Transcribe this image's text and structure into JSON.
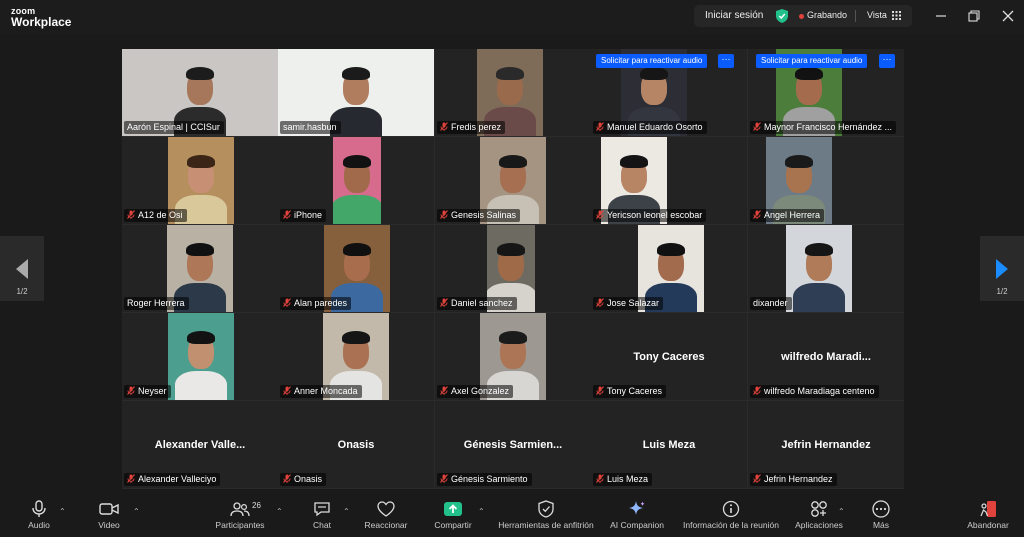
{
  "app": {
    "brand_top": "zoom",
    "brand_bottom": "Workplace"
  },
  "topbar": {
    "sign_in": "Iniciar sesión",
    "recording": "Grabando",
    "view": "Vista"
  },
  "pagination": {
    "left": "1/2",
    "right": "1/2"
  },
  "request_audio_label": "Solicitar para reactivar audio",
  "request_more": "···",
  "participants": [
    {
      "name": "Aarón Espinal | CCISur",
      "muted": false
    },
    {
      "name": "samir.hasbun",
      "muted": false
    },
    {
      "name": "Fredis perez",
      "muted": true
    },
    {
      "name": "Manuel Eduardo Osorto",
      "muted": true
    },
    {
      "name": "Maynor Francisco Hernández ...",
      "muted": true
    },
    {
      "name": "A12 de Osi",
      "muted": true
    },
    {
      "name": "iPhone",
      "muted": true
    },
    {
      "name": "Genesis Salinas",
      "muted": true
    },
    {
      "name": "Yericson leonel escobar",
      "muted": true
    },
    {
      "name": "Angel Herrera",
      "muted": true
    },
    {
      "name": "Roger Herrera",
      "muted": false
    },
    {
      "name": "Alan paredes",
      "muted": true
    },
    {
      "name": "Daniel sanchez",
      "muted": true
    },
    {
      "name": "Jose Salazar",
      "muted": true
    },
    {
      "name": "dixander",
      "muted": false
    },
    {
      "name": "Neyser",
      "muted": true
    },
    {
      "name": "Anner Moncada",
      "muted": true
    },
    {
      "name": "Axel Gonzalez",
      "muted": true
    },
    {
      "name": "Tony Caceres",
      "muted": true,
      "display": "Tony Caceres"
    },
    {
      "name": "wilfredo Maradiaga centeno",
      "muted": true,
      "display": "wilfredo  Maradi..."
    },
    {
      "name": "Alexander Valleciyo",
      "muted": true,
      "display": "Alexander  Valle..."
    },
    {
      "name": "Onasis",
      "muted": true,
      "display": "Onasis"
    },
    {
      "name": "Génesis Sarmiento",
      "muted": true,
      "display": "Génesis  Sarmien..."
    },
    {
      "name": "Luis Meza",
      "muted": true,
      "display": "Luis Meza"
    },
    {
      "name": "Jefrin Hernandez",
      "muted": true,
      "display": "Jefrin Hernandez"
    }
  ],
  "toolbar": {
    "audio": "Audio",
    "video": "Video",
    "participants": "Participantes",
    "participants_count": "26",
    "chat": "Chat",
    "react": "Reaccionar",
    "share": "Compartir",
    "host_tools": "Herramientas de anfitrión",
    "ai_companion": "AI Companion",
    "meeting_info": "Información de la reunión",
    "apps": "Aplicaciones",
    "more": "Más",
    "leave": "Abandonar"
  },
  "colors": {
    "accent": "#0b5cff",
    "speaker_border": "#22c08a",
    "muted_red": "#e0433b",
    "share_green": "#22c08a",
    "leave_red": "#e0433b"
  }
}
